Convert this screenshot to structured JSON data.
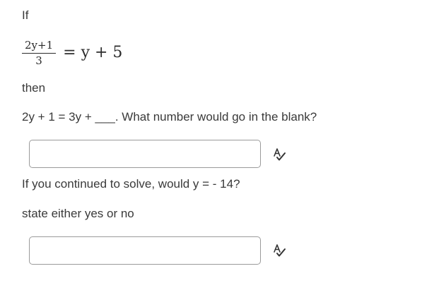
{
  "question": {
    "if_label": "If",
    "equation": {
      "numerator": "2y+1",
      "denominator": "3",
      "right_side": "= y + 5"
    },
    "then_label": "then",
    "line1": "2y + 1 =  3y + ___.  What number would go in the blank?",
    "line2": "If you continued to solve, would y = - 14?",
    "line3": "state either yes or no"
  },
  "answers": {
    "blank_value": "",
    "yes_no_value": ""
  },
  "icons": {
    "spellcheck": "spellcheck-icon"
  }
}
